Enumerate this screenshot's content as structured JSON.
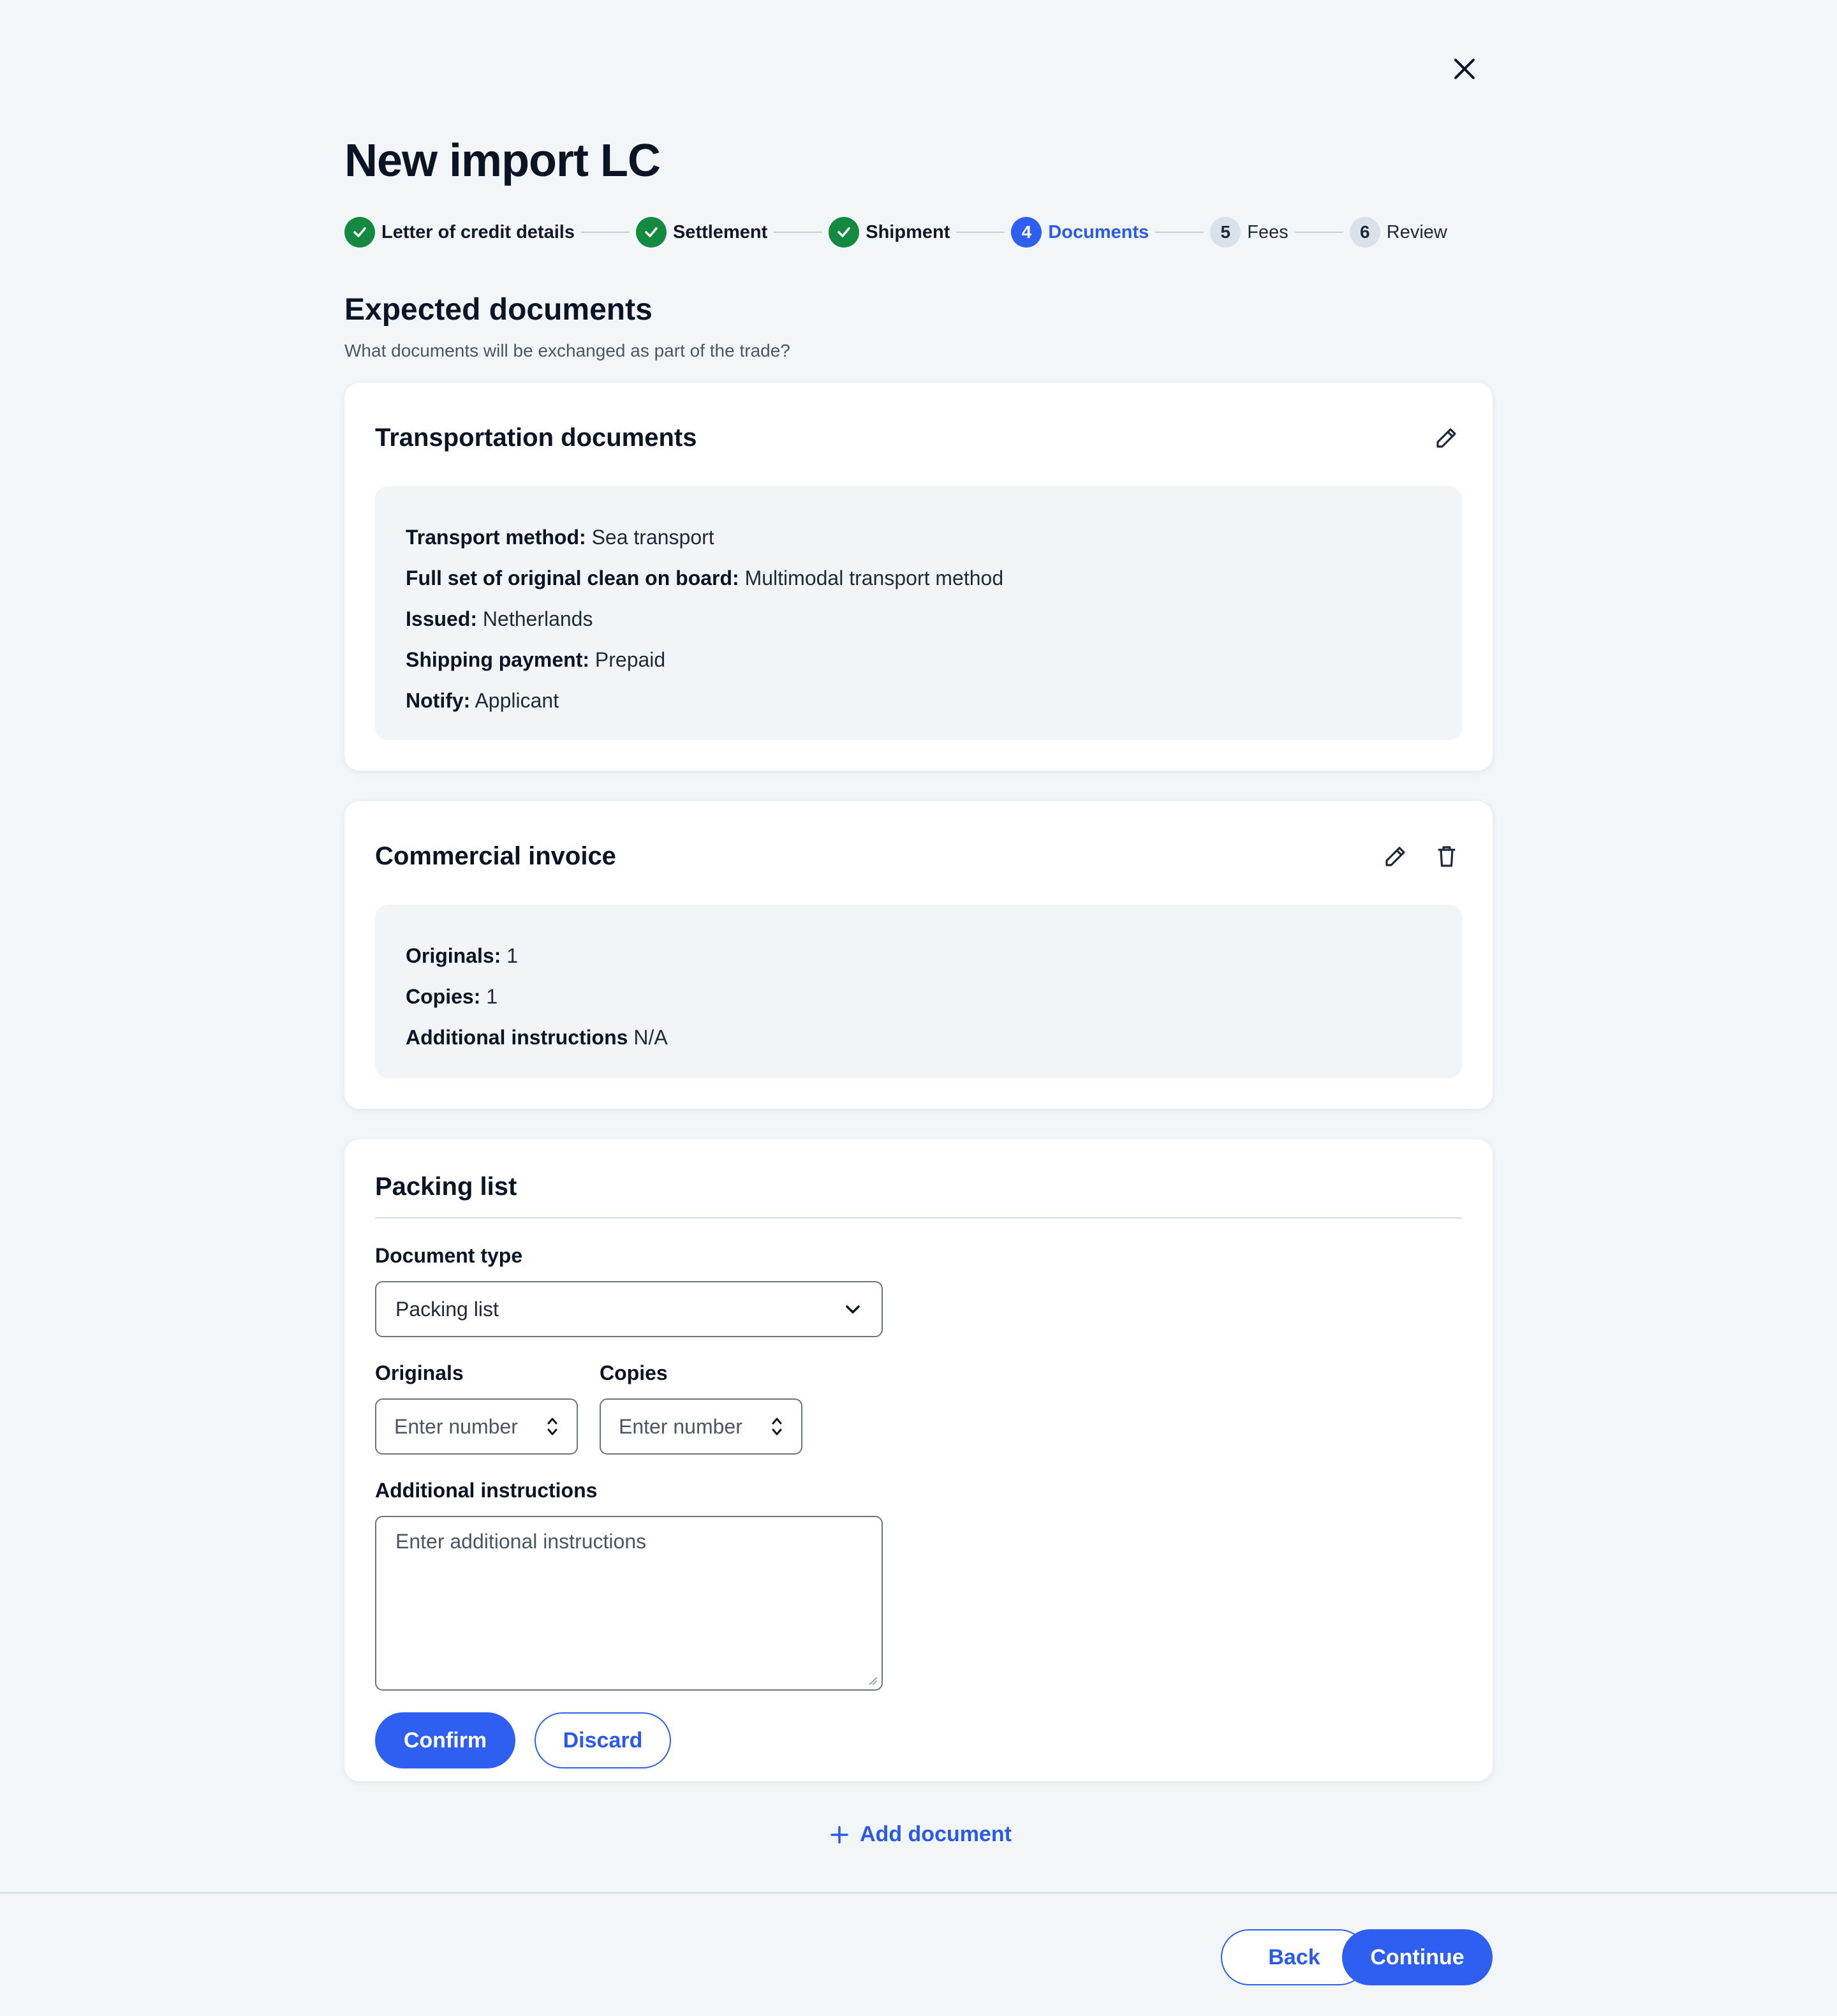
{
  "page": {
    "title": "New import LC"
  },
  "stepper": {
    "steps": [
      {
        "number": "1",
        "label": "Letter of credit details",
        "state": "done"
      },
      {
        "number": "2",
        "label": "Settlement",
        "state": "done"
      },
      {
        "number": "3",
        "label": "Shipment",
        "state": "done"
      },
      {
        "number": "4",
        "label": "Documents",
        "state": "active"
      },
      {
        "number": "5",
        "label": "Fees",
        "state": "todo"
      },
      {
        "number": "6",
        "label": "Review",
        "state": "todo"
      }
    ]
  },
  "section": {
    "title": "Expected documents",
    "subtitle": "What documents will be exchanged as part of the trade?"
  },
  "transport_card": {
    "title": "Transportation documents",
    "rows": [
      {
        "key": "Transport method:",
        "value": "Sea transport"
      },
      {
        "key": "Full set of original clean on board:",
        "value": "Multimodal transport method"
      },
      {
        "key": "Issued:",
        "value": "Netherlands"
      },
      {
        "key": "Shipping payment:",
        "value": "Prepaid"
      },
      {
        "key": "Notify:",
        "value": "Applicant"
      }
    ]
  },
  "invoice_card": {
    "title": "Commercial invoice",
    "rows": [
      {
        "key": "Originals:",
        "value": "1"
      },
      {
        "key": "Copies:",
        "value": "1"
      },
      {
        "key": "Additional instructions",
        "value": "N/A"
      }
    ]
  },
  "packing_card": {
    "title": "Packing list",
    "document_type_label": "Document type",
    "document_type_value": "Packing list",
    "originals_label": "Originals",
    "originals_placeholder": "Enter number",
    "copies_label": "Copies",
    "copies_placeholder": "Enter number",
    "instructions_label": "Additional instructions",
    "instructions_placeholder": "Enter additional instructions",
    "confirm_label": "Confirm",
    "discard_label": "Discard"
  },
  "add_document_label": "Add document",
  "footer": {
    "back_label": "Back",
    "continue_label": "Continue"
  },
  "colors": {
    "primary": "#2f5ff0",
    "success": "#138a3f",
    "background": "#f3f6f9"
  },
  "icons": [
    "close-icon",
    "check-icon",
    "pencil-icon",
    "trash-icon",
    "chevron-down-icon",
    "stepper-arrows-icon",
    "plus-icon"
  ]
}
